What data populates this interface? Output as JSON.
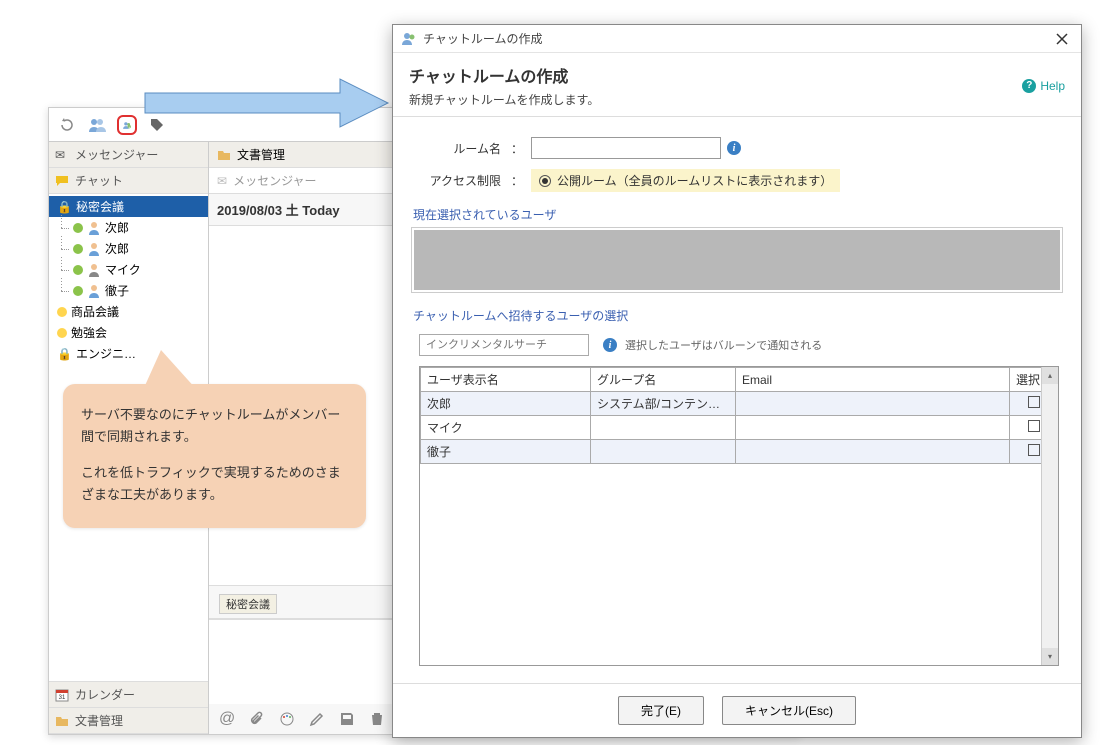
{
  "bg": {
    "sections": {
      "messenger": "メッセンジャー",
      "chat": "チャット",
      "calendar": "カレンダー",
      "docs": "文書管理"
    },
    "tree": {
      "room_selected": "秘密会議",
      "members": [
        "次郎",
        "次郎",
        "マイク",
        "徹子"
      ],
      "rooms_other": [
        "商品会議",
        "勉強会",
        "エンジニ…"
      ]
    },
    "panes": {
      "docs_tab": "文書管理",
      "messenger_tab": "メッセンジャー"
    },
    "date_line": "2019/08/03 土 Today",
    "room_field": "秘密会議"
  },
  "callout": {
    "p1": "サーバ不要なのにチャットルームがメンバー間で同期されます。",
    "p2": "これを低トラフィックで実現するためのさまざまな工夫があります。"
  },
  "dialog": {
    "titlebar": "チャットルームの作成",
    "title": "チャットルームの作成",
    "subtitle": "新規チャットルームを作成します。",
    "help": "Help",
    "room_label": "ルーム名",
    "access_label": "アクセス制限",
    "access_option": "公開ルーム（全員のルームリストに表示されます）",
    "legend_selected": "現在選択されているユーザ",
    "legend_invite": "チャットルームへ招待するユーザの選択",
    "search_placeholder": "インクリメンタルサーチ",
    "balloon_hint": "選択したユーザはバルーンで通知される",
    "table": {
      "col_user": "ユーザ表示名",
      "col_group": "グループ名",
      "col_email": "Email",
      "col_select": "選択",
      "rows": [
        {
          "user": "次郎",
          "group": "システム部/コンテン…"
        },
        {
          "user": "マイク",
          "group": ""
        },
        {
          "user": "徹子",
          "group": ""
        }
      ]
    },
    "ok": "完了(E)",
    "cancel": "キャンセル(Esc)"
  }
}
